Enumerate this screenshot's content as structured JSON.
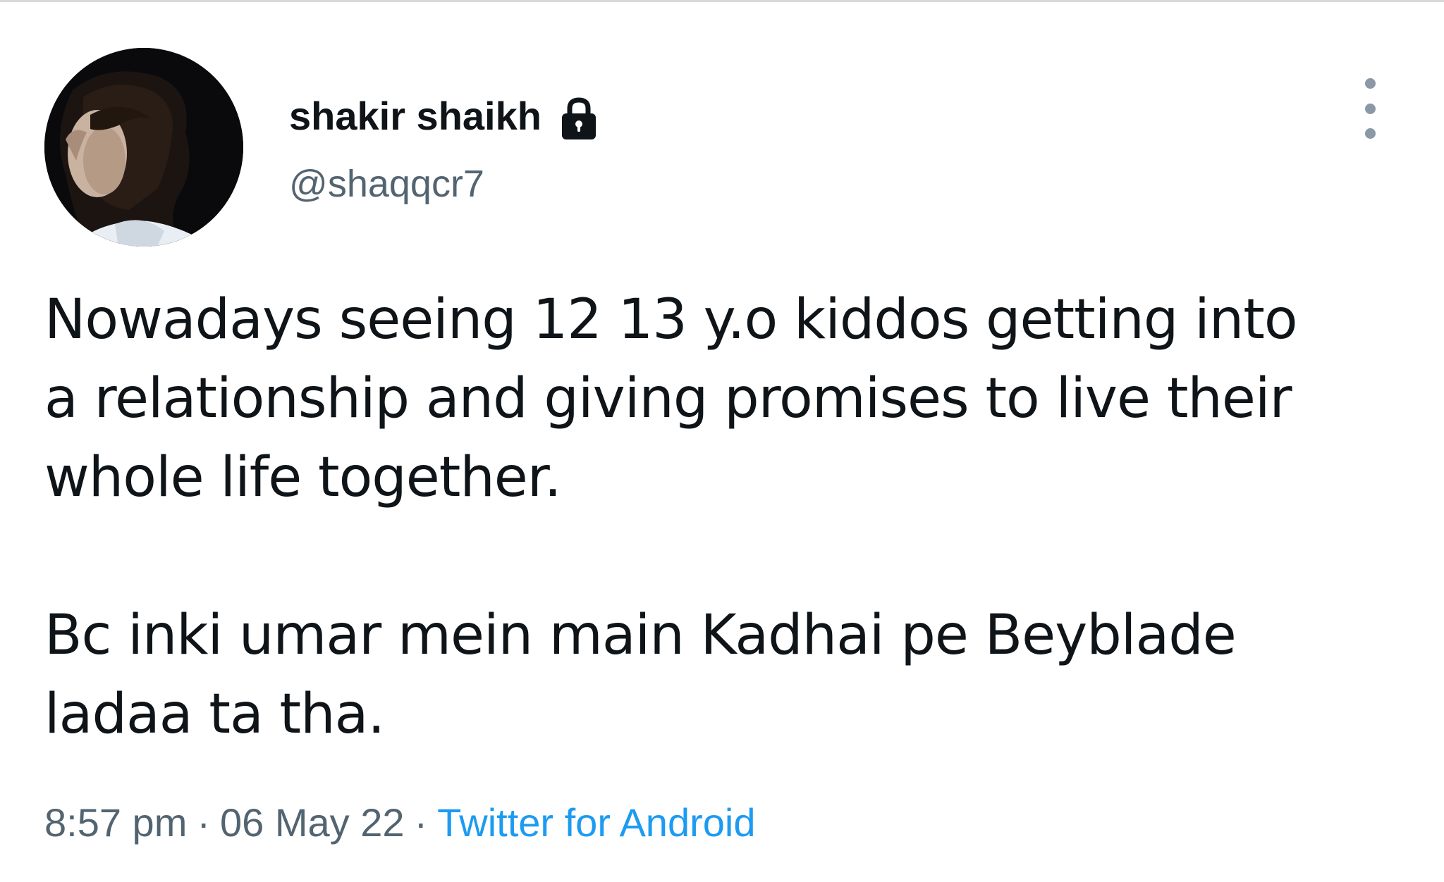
{
  "tweet": {
    "author": {
      "name": "shakir shaikh",
      "handle": "@shaqqcr7",
      "protected_icon": "lock-icon",
      "avatar": "profile-photo"
    },
    "more_icon": "more-vertical-icon",
    "text_paragraphs": [
      "Nowadays seeing 12 13 y.o kiddos getting into\na relationship and giving promises to live their\nwhole life together.",
      "Bc inki umar mein main Kadhai pe Beyblade\nladaa ta tha."
    ],
    "meta": {
      "time": "8:57 pm",
      "separator": "·",
      "date": "06 May 22",
      "source": "Twitter for Android"
    }
  },
  "colors": {
    "text_primary": "#0f1419",
    "text_secondary": "#536471",
    "link": "#1d9bf0",
    "background": "#ffffff"
  }
}
